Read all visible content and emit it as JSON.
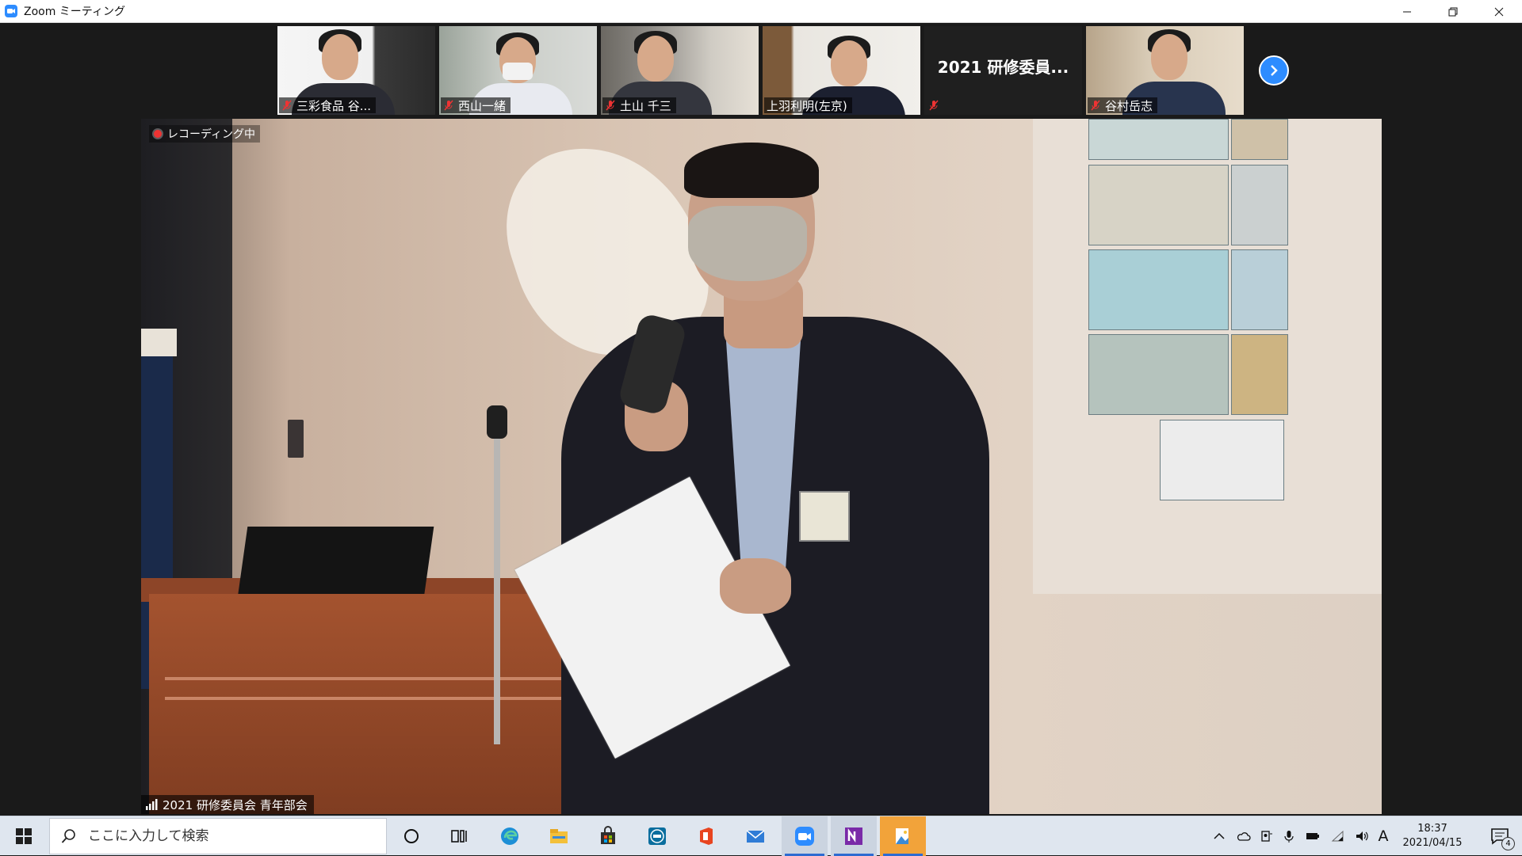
{
  "window": {
    "title": "Zoom ミーティング",
    "app_icon": "zoom-icon",
    "controls": [
      "minimize-icon",
      "restore-icon",
      "close-icon"
    ]
  },
  "participants": [
    {
      "name": "三彩食品 谷...",
      "muted": true
    },
    {
      "name": "西山一緒",
      "muted": true
    },
    {
      "name": "土山 千三",
      "muted": true
    },
    {
      "name": "上羽利明(左京)",
      "muted": false
    },
    {
      "name": "2021 研修委員...",
      "label": "",
      "muted": true,
      "video_off": true
    },
    {
      "name": "谷村岳志",
      "muted": true
    }
  ],
  "next_page_icon": "chevron-right-icon",
  "main": {
    "recording_label": "レコーディング中",
    "speaker_name": "2021 研修委員会 青年部会"
  },
  "taskbar": {
    "search_placeholder": "ここに入力して検索",
    "apps": [
      "task-view-icon",
      "cortana-icon",
      "edge-icon",
      "file-explorer-icon",
      "store-icon",
      "dell-icon",
      "office-icon",
      "mail-icon",
      "zoom-icon",
      "onenote-icon",
      "photos-icon"
    ],
    "ime": "A",
    "time": "18:37",
    "date": "2021/04/15",
    "notification_count": "4"
  },
  "colors": {
    "zoom_blue": "#2d8cff",
    "recording_red": "#ee3333",
    "taskbar_bg": "#dfe6ef"
  }
}
